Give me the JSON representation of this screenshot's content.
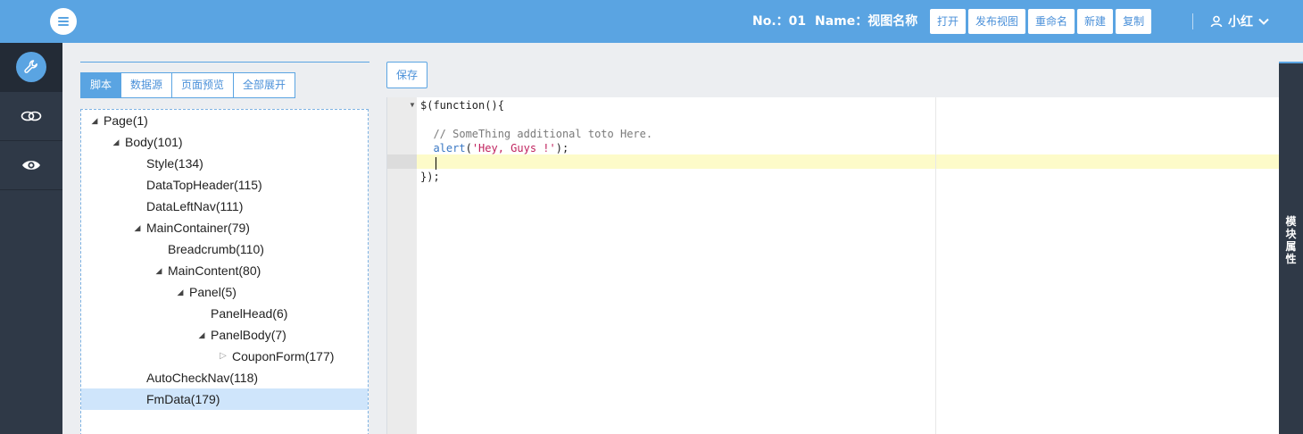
{
  "header": {
    "no_text": "No.：01",
    "name_text": "Name：视图名称",
    "actions": [
      "打开",
      "发布视图",
      "重命名",
      "新建",
      "复制"
    ],
    "user_name": "小红"
  },
  "sidebar": {
    "items": [
      {
        "icon": "wrench-icon",
        "active": true
      },
      {
        "icon": "link-icon",
        "active": false
      },
      {
        "icon": "eye-icon",
        "active": false
      }
    ]
  },
  "tabs": [
    {
      "label": "脚本",
      "active": true
    },
    {
      "label": "数据源",
      "active": false
    },
    {
      "label": "页面预览",
      "active": false
    },
    {
      "label": "全部展开",
      "active": false
    }
  ],
  "tree": [
    {
      "label": "Page(1)",
      "level": 0,
      "toggle": "open"
    },
    {
      "label": "Body(101)",
      "level": 1,
      "toggle": "open"
    },
    {
      "label": "Style(134)",
      "level": 2,
      "toggle": "none"
    },
    {
      "label": "DataTopHeader(115)",
      "level": 2,
      "toggle": "none"
    },
    {
      "label": "DataLeftNav(111)",
      "level": 2,
      "toggle": "none"
    },
    {
      "label": "MainContainer(79)",
      "level": 2,
      "toggle": "open"
    },
    {
      "label": "Breadcrumb(110)",
      "level": 3,
      "toggle": "none"
    },
    {
      "label": "MainContent(80)",
      "level": 3,
      "toggle": "open"
    },
    {
      "label": "Panel(5)",
      "level": 4,
      "toggle": "open"
    },
    {
      "label": "PanelHead(6)",
      "level": 5,
      "toggle": "none"
    },
    {
      "label": "PanelBody(7)",
      "level": 5,
      "toggle": "open"
    },
    {
      "label": "CouponForm(177)",
      "level": 6,
      "toggle": "closed"
    },
    {
      "label": "AutoCheckNav(118)",
      "level": 2,
      "toggle": "none"
    },
    {
      "label": "FmData(179)",
      "level": 2,
      "toggle": "none",
      "selected": true
    }
  ],
  "editor": {
    "save_label": "保存",
    "lines": {
      "l1": "$(function(){",
      "l3": "// SomeThing additional toto Here.",
      "l4_fn": "alert",
      "l4_open": "(",
      "l4_str": "'Hey, Guys !'",
      "l4_close": ");",
      "l6": "});"
    }
  },
  "side_panel": {
    "label": "模块属性"
  },
  "colors": {
    "primary": "#5aa4e2",
    "dark": "#2f3947",
    "selected_row": "#cfe5fb",
    "active_line": "#fdfbc9"
  }
}
